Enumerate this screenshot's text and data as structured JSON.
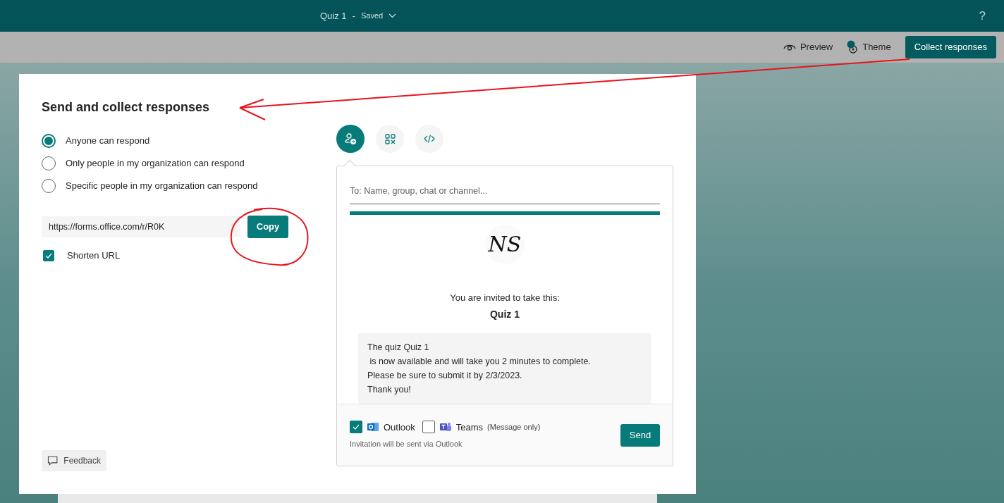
{
  "header": {
    "title": "Quiz 1",
    "separator": "-",
    "status": "Saved",
    "help": "?"
  },
  "toolbar": [
    {
      "label": "Preview",
      "kind": "preview"
    },
    {
      "label": "Theme",
      "kind": "theme"
    },
    {
      "label": "Collect responses",
      "kind": "primary"
    }
  ],
  "dialog": {
    "title": "Send and collect responses",
    "audience": [
      {
        "label": "Anyone can respond",
        "selected": true
      },
      {
        "label": "Only people in my organization can respond",
        "selected": false
      },
      {
        "label": "Specific people in my organization can respond",
        "selected": false
      }
    ],
    "link": {
      "value": "https://forms.office.com/r/R0K",
      "copy": "Copy"
    },
    "shorten": {
      "label": "Shorten URL",
      "checked": true
    },
    "feedback": "Feedback",
    "share_tabs": [
      {
        "kind": "invite",
        "selected": true
      },
      {
        "kind": "qr",
        "selected": false
      },
      {
        "kind": "embed",
        "selected": false
      }
    ],
    "invite": {
      "to_placeholder": "To: Name, group, chat or channel...",
      "logo": "NS",
      "invited": "You are invited to take this:",
      "quiz_title": "Quiz 1",
      "message": [
        "The quiz Quiz 1",
        " is now available and will take you 2 minutes to complete.",
        "Please be sure to submit it by 2/3/2023.",
        "Thank you!"
      ],
      "channels": [
        {
          "label": "Outlook",
          "kind": "outlook",
          "checked": true
        },
        {
          "label": "Teams",
          "note": "(Message only)",
          "kind": "teams",
          "checked": false
        }
      ],
      "hint": "Invitation will be sent via Outlook",
      "send": "Send"
    }
  },
  "annotations": {
    "arrow": true,
    "circle": true
  }
}
